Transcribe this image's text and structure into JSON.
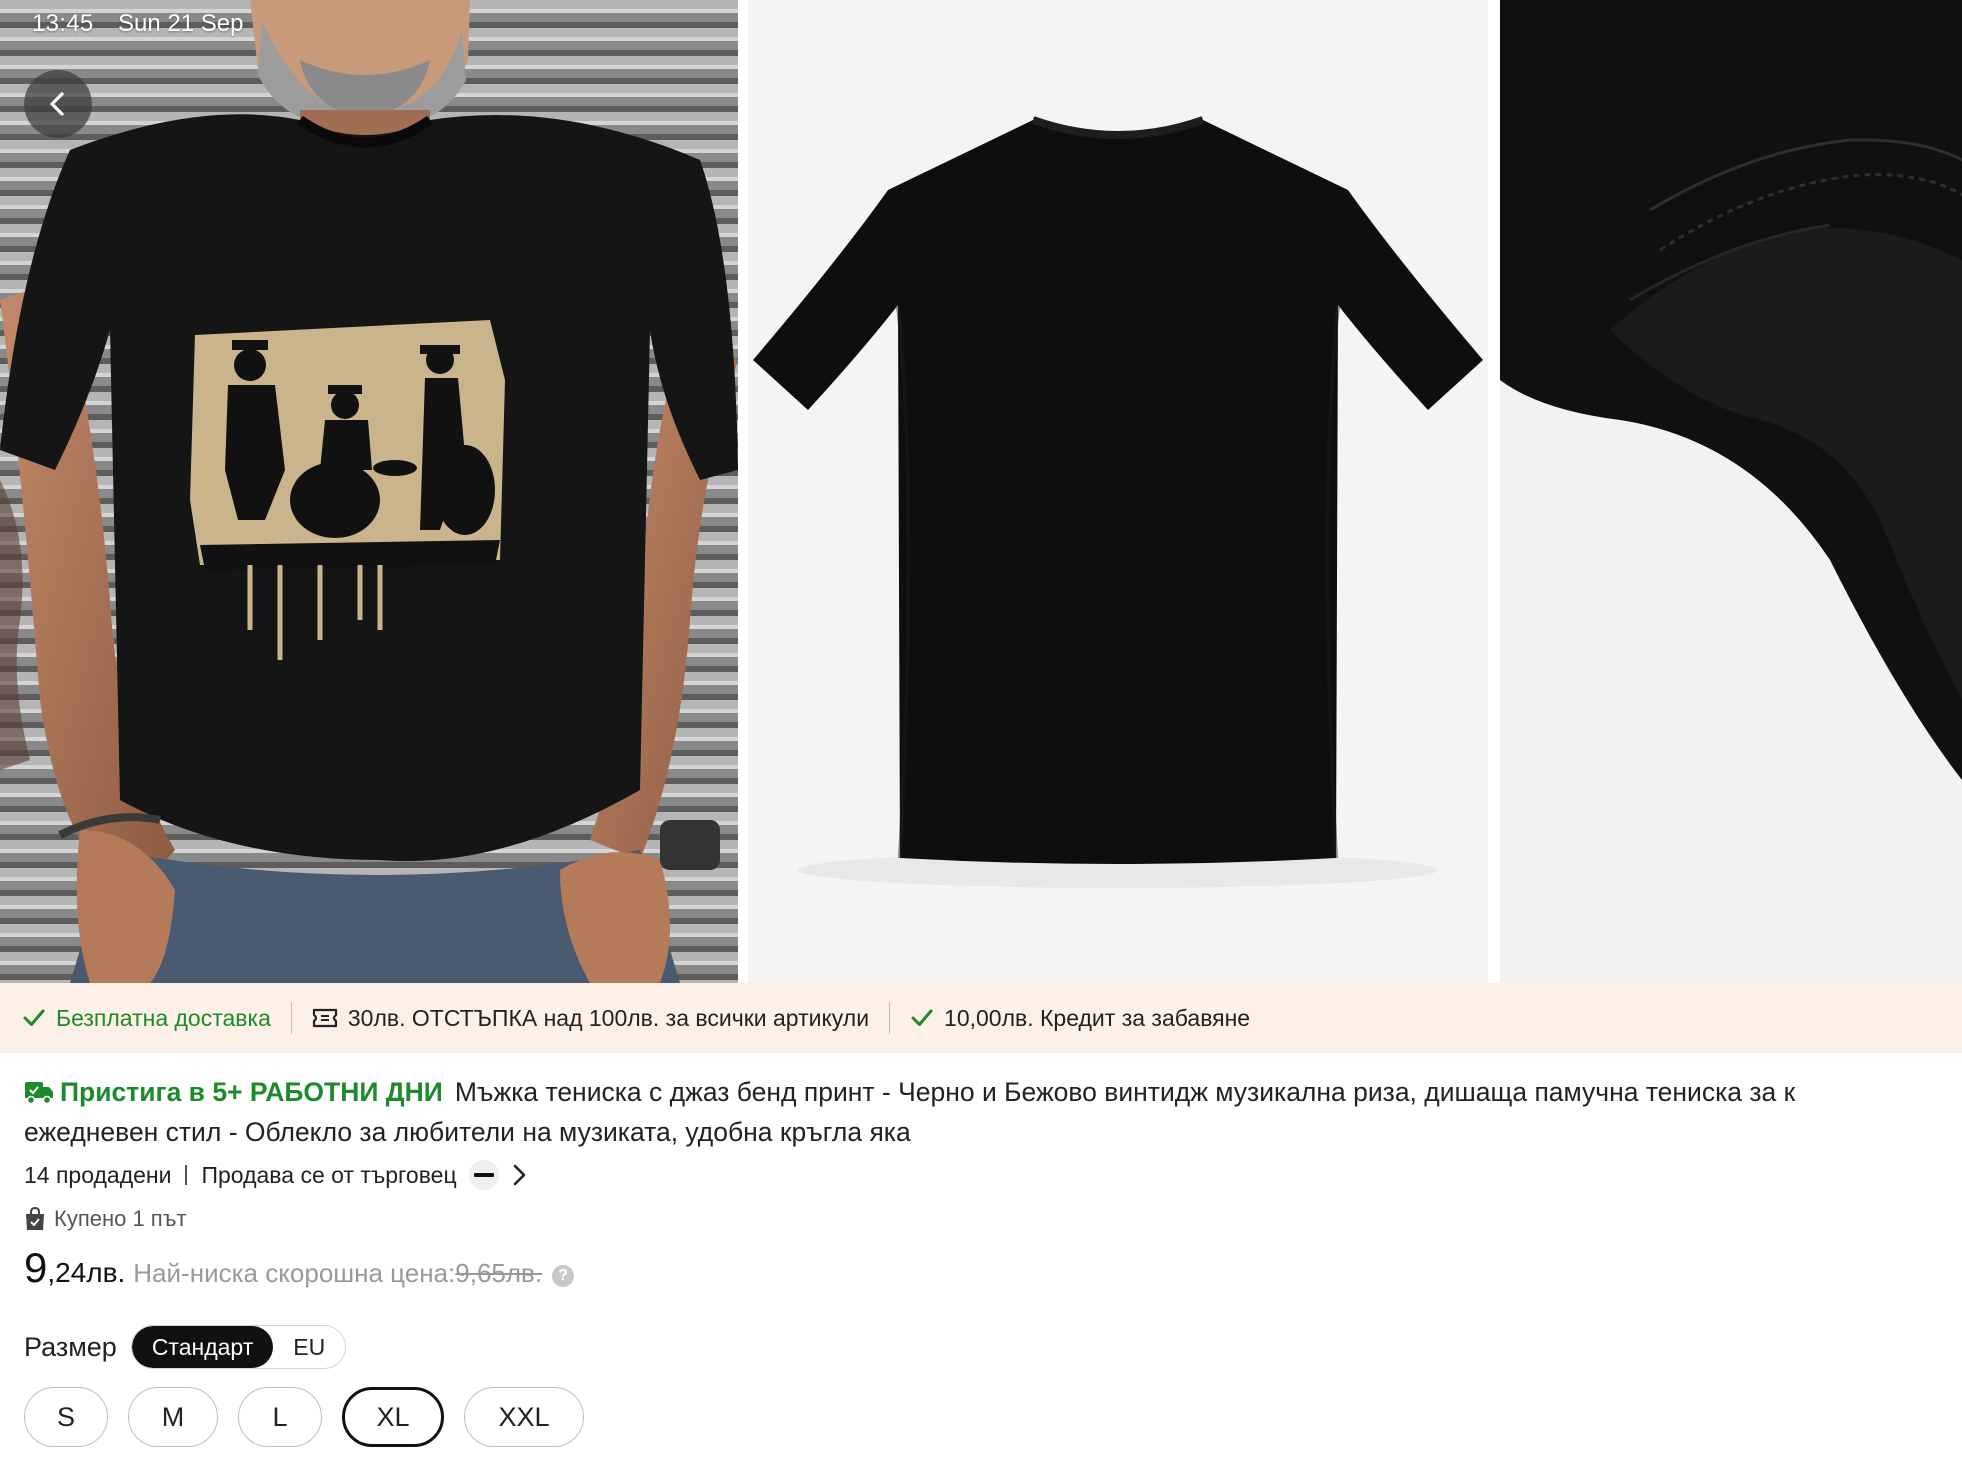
{
  "status_bar": {
    "time": "13:45",
    "date": "Sun 21 Sep"
  },
  "gallery": {
    "back_icon": "chevron-left-icon",
    "images": [
      {
        "name": "model-wearing-tshirt-photo"
      },
      {
        "name": "tshirt-back-photo"
      },
      {
        "name": "fabric-detail-photo"
      }
    ]
  },
  "promo": {
    "free_delivery": "Безплатна доставка",
    "discount": "30лв. ОТСТЪПКА над 100лв. за всички артикули",
    "credit": "10,00лв. Кредит за забавяне"
  },
  "product": {
    "arrival": "Пристига в 5+ РАБОТНИ ДНИ",
    "title_line1": "Мъжка тениска с джаз бенд принт - Черно и Бежово винтидж музикална риза, дишаща памучна тениска за к",
    "title_line2": "ежедневен стил - Облекло за любители на музиката, удобна кръгла яка",
    "sold": "14 продадени",
    "sold_by": "Продава се от търговец",
    "bought": "Купено 1 път",
    "price_main": "9",
    "price_cents": ",24",
    "price_currency": "лв.",
    "lowest_label": "Най-ниска скорошна цена:",
    "lowest_value": "9,65лв."
  },
  "size": {
    "label": "Размер",
    "standards": [
      "Стандарт",
      "EU"
    ],
    "active_standard": "Стандарт",
    "options": [
      "S",
      "M",
      "L",
      "XL",
      "XXL"
    ],
    "selected": "XL"
  },
  "colors": {
    "accent_green": "#1d8a2b",
    "promo_bg": "#fdf0e6",
    "selected_border": "#111111"
  }
}
